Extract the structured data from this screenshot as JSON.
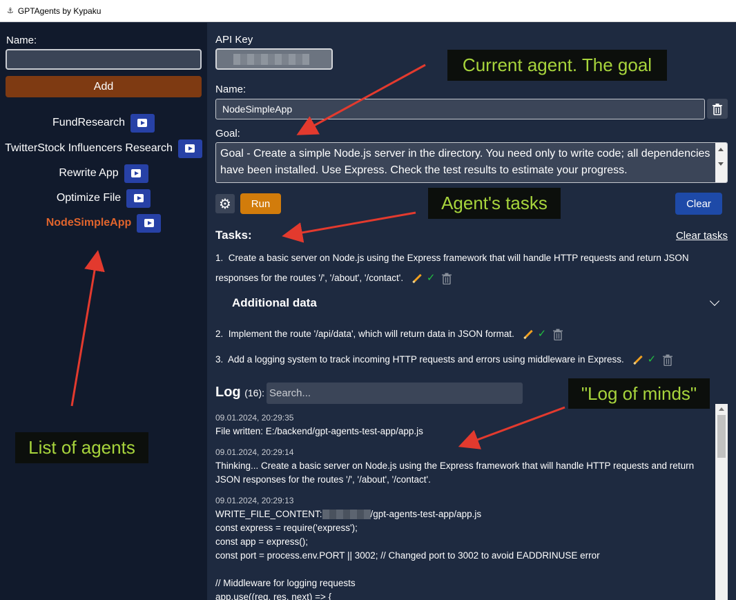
{
  "window": {
    "title": "GPTAgents by Kypaku"
  },
  "sidebar": {
    "name_label": "Name:",
    "name_value": "",
    "add_label": "Add",
    "agents": [
      {
        "name": "FundResearch",
        "active": false
      },
      {
        "name": "TwitterStock Influencers Research",
        "active": false
      },
      {
        "name": "Rewrite App",
        "active": false
      },
      {
        "name": "Optimize File",
        "active": false
      },
      {
        "name": "NodeSimpleApp",
        "active": true
      }
    ]
  },
  "main": {
    "api_key_label": "API Key",
    "name_label": "Name:",
    "name_value": "NodeSimpleApp",
    "goal_label": "Goal:",
    "goal_text": "Goal - Create a simple Node.js server in the directory. You need only to write code; all dependencies have been installed. Use Express. Check the test results to estimate your progress.",
    "run_label": "Run",
    "clear_label": "Clear",
    "tasks_title": "Tasks:",
    "clear_tasks_label": "Clear tasks",
    "tasks": [
      {
        "num": "1.",
        "text": "Create a basic server on Node.js using the Express framework that will handle HTTP requests and return JSON responses for the routes '/', '/about', '/contact'."
      },
      {
        "num": "2.",
        "text": "Implement the route '/api/data', which will return data in JSON format."
      },
      {
        "num": "3.",
        "text": "Add a logging system to track incoming HTTP requests and errors using middleware in Express."
      }
    ],
    "additional_data_label": "Additional data",
    "log_title": "Log",
    "log_count": "(16):",
    "search_placeholder": "Search...",
    "log": [
      {
        "time": "09.01.2024, 20:29:35",
        "lines": [
          "File written: E:/backend/gpt-agents-test-app/app.js"
        ]
      },
      {
        "time": "09.01.2024, 20:29:14",
        "lines": [
          "Thinking... Create a basic server on Node.js using the Express framework that will handle HTTP requests and return",
          "JSON responses for the routes '/', '/about', '/contact'."
        ]
      },
      {
        "time": "09.01.2024, 20:29:13",
        "prefix": "WRITE_FILE_CONTENT:",
        "suffix": "/gpt-agents-test-app/app.js",
        "code": [
          "const express = require('express');",
          "const app = express();",
          "const port = process.env.PORT || 3002; // Changed port to 3002 to avoid EADDRINUSE error",
          "",
          "// Middleware for logging requests",
          "app.use((req, res, next) => {"
        ]
      }
    ]
  },
  "annotations": {
    "current_agent": "Current agent. The goal",
    "tasks": "Agent's tasks",
    "log": "\"Log of minds\"",
    "list": "List of agents"
  },
  "colors": {
    "accent_orange": "#d27c0b",
    "add_brown": "#7e3a12",
    "primary_blue": "#1e4aa8",
    "active_agent": "#e0642c",
    "annotation_text": "#a7d43c",
    "arrow_red": "#e33a2e"
  }
}
